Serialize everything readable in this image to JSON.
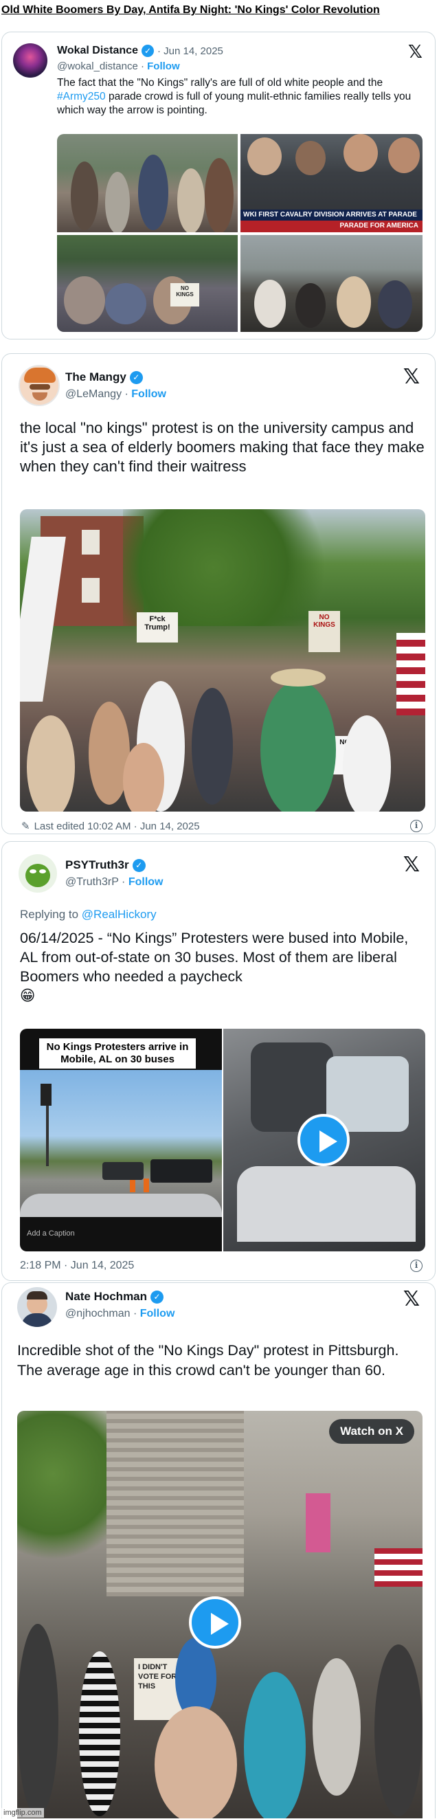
{
  "headline": "Old White Boomers By Day, Antifa By Night: 'No Kings' Color Revolution",
  "tweets": [
    {
      "name": "Wokal Distance",
      "handle": "@wokal_distance",
      "date": "· Jun 14, 2025",
      "follow": "Follow",
      "text_before": "The fact that the \"No Kings\" rally's are full of old white people and the ",
      "hashtag": "#Army250",
      "text_after": " parade crowd is full of young mulit-ethnic families really tells you which way the arrow is pointing.",
      "overlay_chyron": "WKI FIRST CAVALRY DIVISION ARRIVES AT PARADE",
      "overlay_sub": "PARADE FOR AMERICA",
      "sign_text": "NO KINGS"
    },
    {
      "name": "The Mangy",
      "handle": "@LeMangy",
      "follow": "Follow",
      "text": "the local \"no kings\" protest is on the university campus and it's just a sea of elderly boomers making that face they make when they can't find their waitress",
      "edited": "Last edited 10:02 AM · Jun 14, 2025",
      "sign_texts": [
        "F*ck Trump!",
        "NO KINGS",
        "NO KINGS"
      ]
    },
    {
      "name": "PSYTruth3r",
      "handle": "@Truth3rP",
      "follow": "Follow",
      "reply_prefix": "Replying to ",
      "reply_to": "@RealHickory",
      "text": "06/14/2025 - “No Kings” Protesters were bused into Mobile, AL from out-of-state on 30 buses. Most of them are liberal Boomers who needed a paycheck",
      "emoji": "😁",
      "video_caption": "No Kings Protesters arrive in Mobile, AL on 30 buses",
      "add_caption": "Add a Caption",
      "time": "2:18 PM · Jun 14, 2025"
    },
    {
      "name": "Nate Hochman",
      "handle": "@njhochman",
      "follow": "Follow",
      "text": "Incredible shot of the \"No Kings Day\" protest in Pittsburgh. The average age in this crowd can't be younger than 60.",
      "watch": "Watch on X",
      "sign_text": "I DIDN'T VOTE FOR THIS"
    }
  ],
  "watermark": "imgflip.com",
  "colors": {
    "accent": "#1d9bf0",
    "text": "#0f1419",
    "muted": "#536471",
    "border": "#cfd9de"
  },
  "icons": [
    "x-logo-icon",
    "verified-badge-icon",
    "pencil-icon",
    "info-icon",
    "play-icon"
  ]
}
